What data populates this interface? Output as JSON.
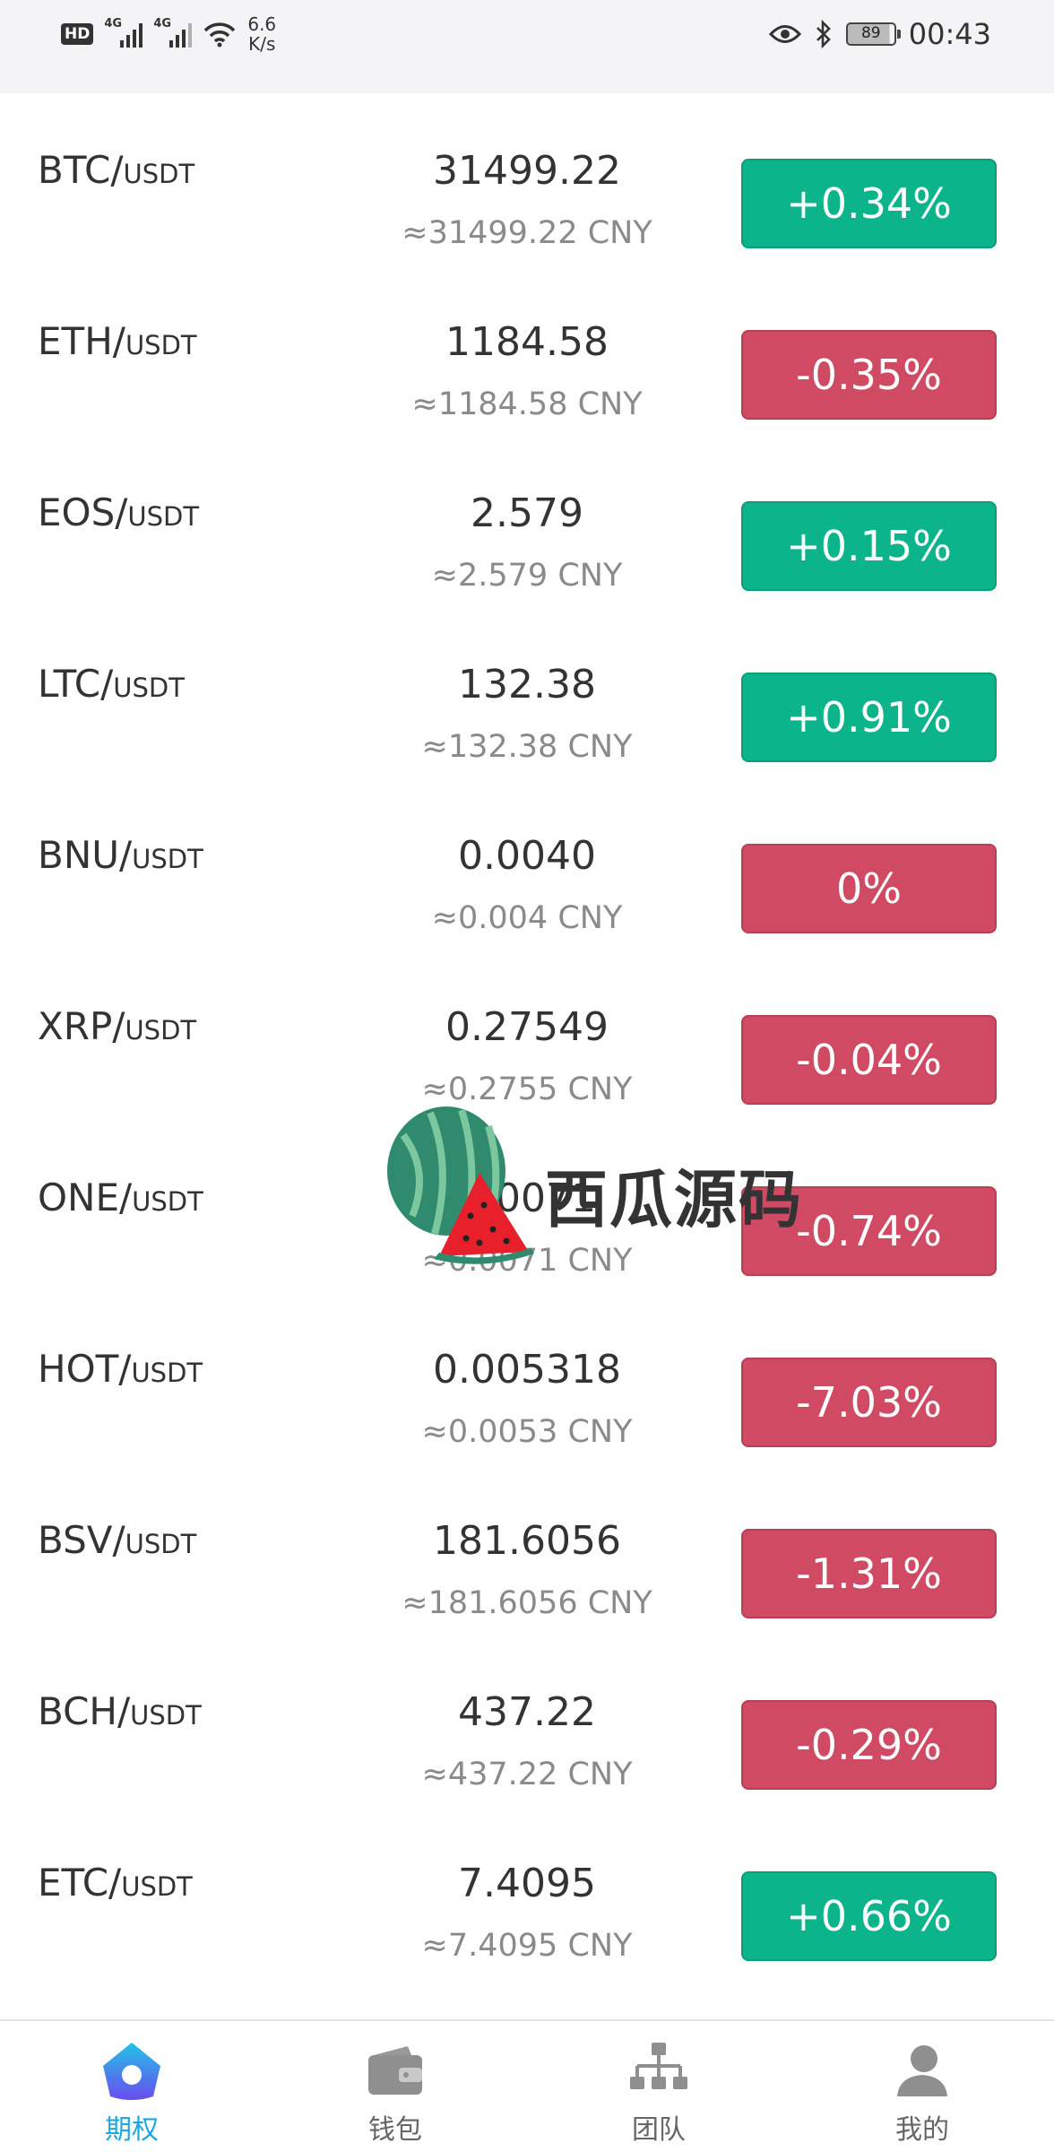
{
  "status_bar": {
    "hd": "HD",
    "net_4g_1": "4G",
    "net_4g_2": "4G",
    "speed_value": "6.6",
    "speed_unit": "K/s",
    "battery": "89",
    "time": "00:43"
  },
  "markets": [
    {
      "base": "BTC/",
      "quote": "USDT",
      "price": "31499.22",
      "cny": "≈31499.22 CNY",
      "change": "+0.34%",
      "direction": "up"
    },
    {
      "base": "ETH/",
      "quote": "USDT",
      "price": "1184.58",
      "cny": "≈1184.58 CNY",
      "change": "-0.35%",
      "direction": "down"
    },
    {
      "base": "EOS/",
      "quote": "USDT",
      "price": "2.579",
      "cny": "≈2.579 CNY",
      "change": "+0.15%",
      "direction": "up"
    },
    {
      "base": "LTC/",
      "quote": "USDT",
      "price": "132.38",
      "cny": "≈132.38 CNY",
      "change": "+0.91%",
      "direction": "up"
    },
    {
      "base": "BNU/",
      "quote": "USDT",
      "price": "0.0040",
      "cny": "≈0.004 CNY",
      "change": "0%",
      "direction": "down"
    },
    {
      "base": "XRP/",
      "quote": "USDT",
      "price": "0.27549",
      "cny": "≈0.2755 CNY",
      "change": "-0.04%",
      "direction": "down"
    },
    {
      "base": "ONE/",
      "quote": "USDT",
      "price": "0.0071",
      "cny": "≈0.0071 CNY",
      "change": "-0.74%",
      "direction": "down"
    },
    {
      "base": "HOT/",
      "quote": "USDT",
      "price": "0.005318",
      "cny": "≈0.0053 CNY",
      "change": "-7.03%",
      "direction": "down"
    },
    {
      "base": "BSV/",
      "quote": "USDT",
      "price": "181.6056",
      "cny": "≈181.6056 CNY",
      "change": "-1.31%",
      "direction": "down"
    },
    {
      "base": "BCH/",
      "quote": "USDT",
      "price": "437.22",
      "cny": "≈437.22 CNY",
      "change": "-0.29%",
      "direction": "down"
    },
    {
      "base": "ETC/",
      "quote": "USDT",
      "price": "7.4095",
      "cny": "≈7.4095 CNY",
      "change": "+0.66%",
      "direction": "up"
    }
  ],
  "watermark": {
    "text": "西瓜源码"
  },
  "colors": {
    "up": "#0bb48b",
    "down": "#d04a63",
    "active_tab": "#1da7e0"
  },
  "tabs": [
    {
      "label": "期权",
      "icon": "home-icon",
      "active": true
    },
    {
      "label": "钱包",
      "icon": "wallet-icon",
      "active": false
    },
    {
      "label": "团队",
      "icon": "team-icon",
      "active": false
    },
    {
      "label": "我的",
      "icon": "profile-icon",
      "active": false
    }
  ]
}
